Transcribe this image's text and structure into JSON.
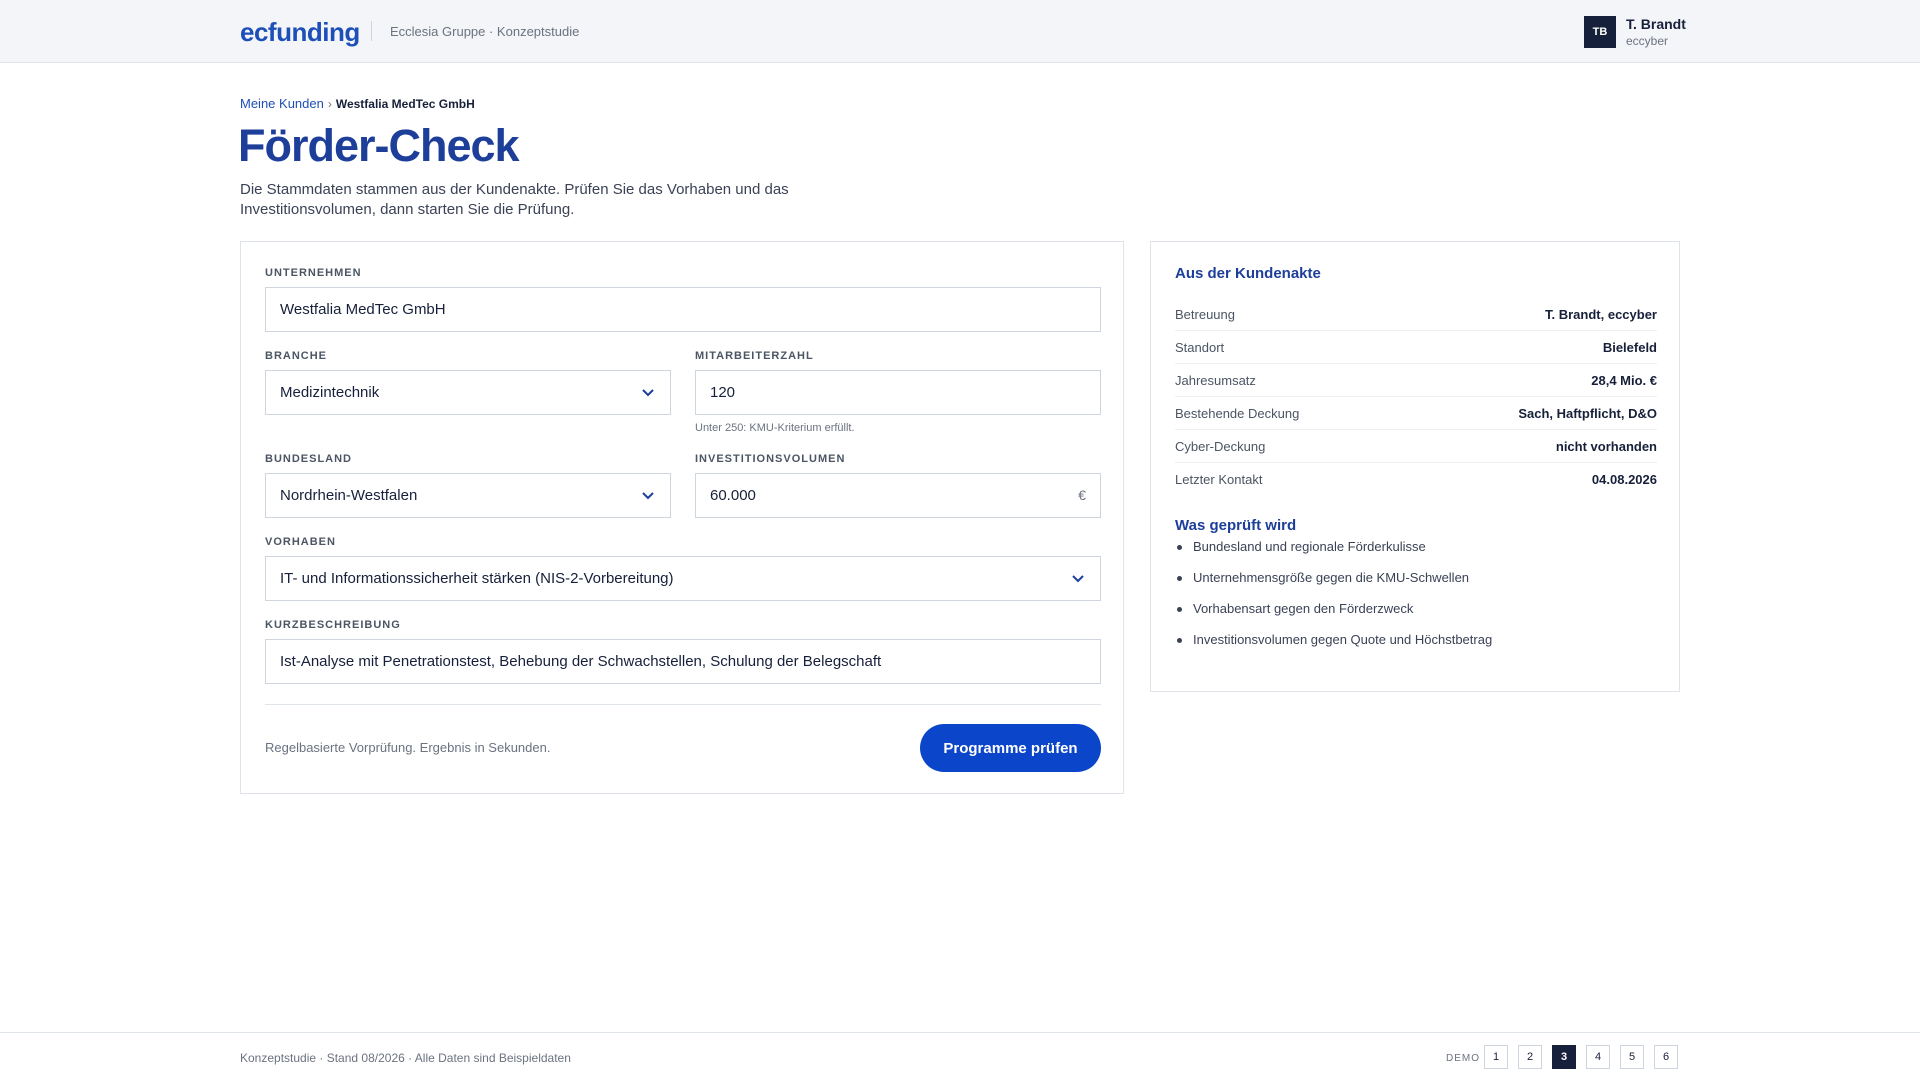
{
  "header": {
    "brand": "ecfunding",
    "subtitle": "Ecclesia Gruppe · Konzeptstudie",
    "user": {
      "initials": "TB",
      "name": "T. Brandt",
      "org": "eccyber"
    }
  },
  "breadcrumb": {
    "parent": "Meine Kunden",
    "separator": "›",
    "current": "Westfalia MedTec GmbH"
  },
  "page": {
    "title": "Förder-Check",
    "intro": "Die Stammdaten stammen aus der Kundenakte. Prüfen Sie das Vorhaben und das Investitionsvolumen, dann starten Sie die Prüfung."
  },
  "form": {
    "company": {
      "label": "UNTERNEHMEN",
      "value": "Westfalia MedTec GmbH"
    },
    "industry": {
      "label": "BRANCHE",
      "value": "Medizintechnik"
    },
    "employees": {
      "label": "MITARBEITERZAHL",
      "value": "120",
      "hint": "Unter 250: KMU-Kriterium erfüllt."
    },
    "state": {
      "label": "BUNDESLAND",
      "value": "Nordrhein-Westfalen"
    },
    "investment": {
      "label": "INVESTITIONSVOLUMEN",
      "value": "60.000",
      "unit": "€"
    },
    "project": {
      "label": "VORHABEN",
      "value": "IT- und Informationssicherheit stärken (NIS-2-Vorbereitung)"
    },
    "description": {
      "label": "KURZBESCHREIBUNG",
      "value": "Ist-Analyse mit Penetrationstest, Behebung der Schwachstellen, Schulung der Belegschaft"
    },
    "footnote": "Regelbasierte Vorprüfung. Ergebnis in Sekunden.",
    "submit_label": "Programme prüfen"
  },
  "customer_file": {
    "title": "Aus der Kundenakte",
    "rows": [
      {
        "key": "Betreuung",
        "value": "T. Brandt, eccyber"
      },
      {
        "key": "Standort",
        "value": "Bielefeld"
      },
      {
        "key": "Jahresumsatz",
        "value": "28,4 Mio. €"
      },
      {
        "key": "Bestehende Deckung",
        "value": "Sach, Haftpflicht, D&O"
      },
      {
        "key": "Cyber-Deckung",
        "value": "nicht vorhanden"
      },
      {
        "key": "Letzter Kontakt",
        "value": "04.08.2026"
      }
    ],
    "checks_title": "Was geprüft wird",
    "checks": [
      "Bundesland und regionale Förderkulisse",
      "Unternehmensgröße gegen die KMU-Schwellen",
      "Vorhabensart gegen den Förderzweck",
      "Investitionsvolumen gegen Quote und Höchstbetrag"
    ]
  },
  "footer": {
    "text": "Konzeptstudie · Stand 08/2026 · Alle Daten sind Beispieldaten",
    "demo_label": "DEMO",
    "pages": [
      "1",
      "2",
      "3",
      "4",
      "5",
      "6"
    ],
    "active_page": "3"
  },
  "colors": {
    "brand": "#1d4fb8",
    "button": "#0b45c9",
    "dark": "#17203a"
  }
}
